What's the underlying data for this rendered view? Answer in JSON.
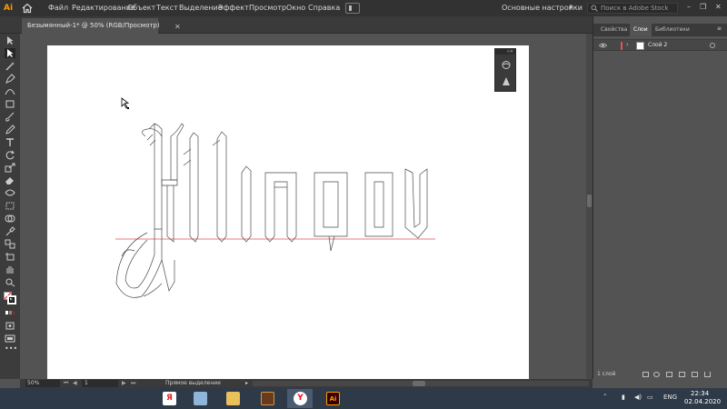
{
  "app": {
    "logo_text": "Ai",
    "menu": [
      "Файл",
      "Редактирование",
      "Объект",
      "Текст",
      "Выделение",
      "Эффект",
      "Просмотр",
      "Окно",
      "Справка"
    ],
    "workspace": "Основные настройки",
    "search_placeholder": "Поиск в Adobe Stock",
    "window_controls": [
      "–",
      "❐",
      "✕"
    ]
  },
  "document": {
    "tab_title": "Безымянный-1* @ 50% (RGB/Просмотр)",
    "close_glyph": "✕",
    "artwork_text": "Hlinov"
  },
  "right_panel": {
    "tabs": [
      "Свойства",
      "Слои",
      "Библиотеки"
    ],
    "active_tab": "Слои",
    "layers": [
      {
        "name": "Слой 2",
        "color": "#e5534b"
      }
    ],
    "layers_count": "1 слой"
  },
  "status": {
    "zoom": "50%",
    "page": "1",
    "tool": "Прямое выделение"
  },
  "taskbar": {
    "apps": [
      {
        "name": "yandex-browser-icon",
        "glyph": "Я",
        "color": "#ffffff",
        "fg": "#d22"
      },
      {
        "name": "image-viewer-icon",
        "glyph": "",
        "color": "#8fb6d8",
        "fg": "#fff"
      },
      {
        "name": "file-explorer-icon",
        "glyph": "",
        "color": "#e9c05a",
        "fg": "#fff"
      },
      {
        "name": "game-icon",
        "glyph": "",
        "color": "#6a3a1c",
        "fg": "#fff"
      },
      {
        "name": "yandex-icon",
        "glyph": "Y",
        "color": "#ffffff",
        "fg": "#e11"
      },
      {
        "name": "illustrator-icon",
        "glyph": "Ai",
        "color": "#330000",
        "fg": "#ff9a00"
      }
    ],
    "lang": "ENG",
    "time": "22:34",
    "date": "02.04.2020"
  },
  "colors": {
    "accent": "#ff9a00",
    "guide": "#e5534b"
  }
}
